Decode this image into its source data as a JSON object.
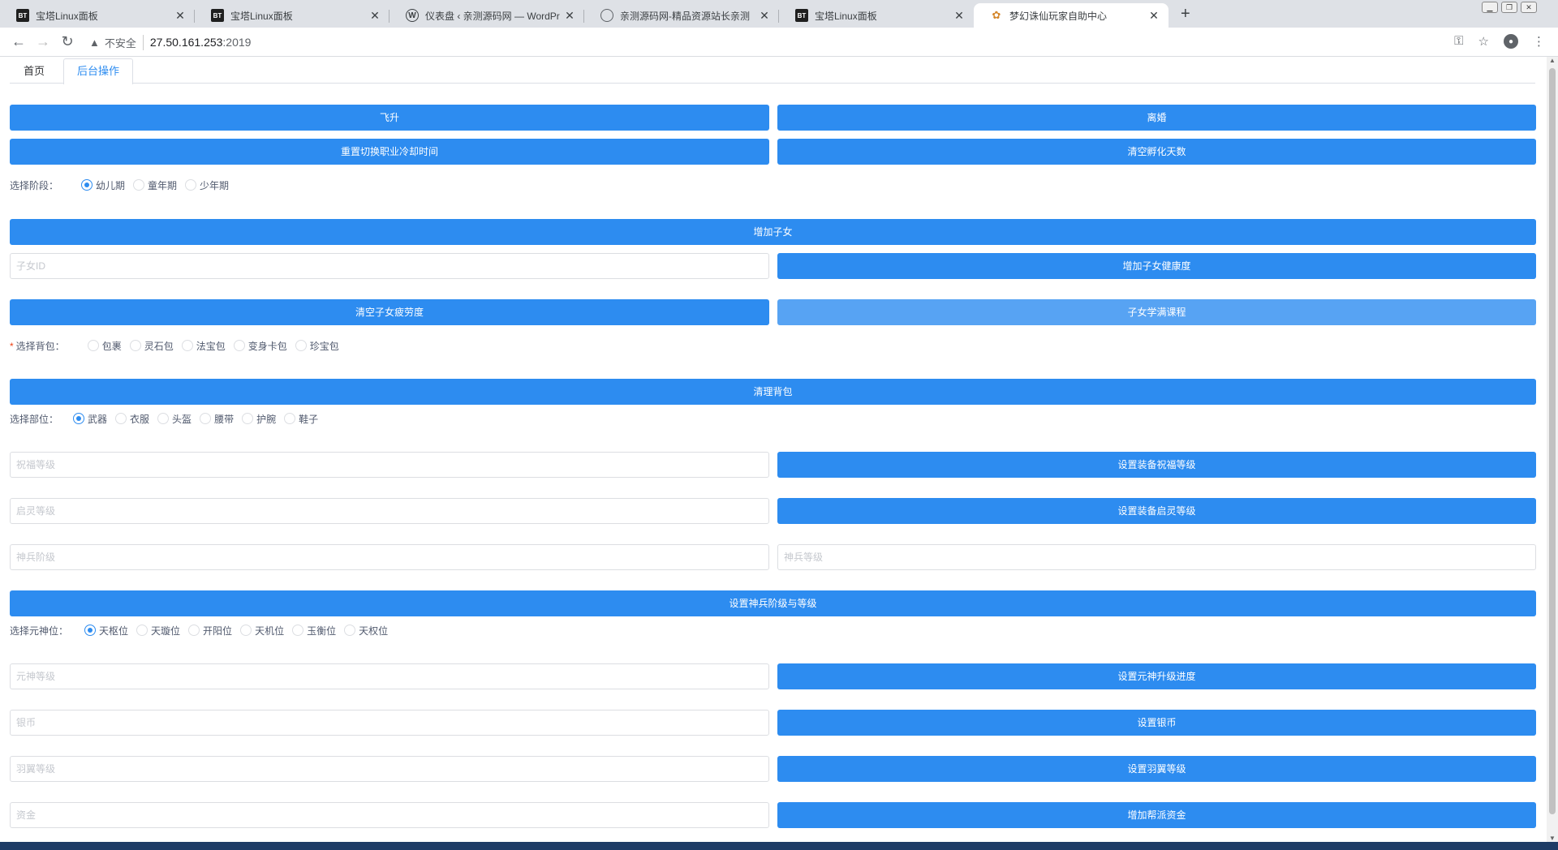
{
  "browser": {
    "tabs": [
      {
        "title": "宝塔Linux面板",
        "icon": "bt-icon"
      },
      {
        "title": "宝塔Linux面板",
        "icon": "bt-icon"
      },
      {
        "title": "仪表盘 ‹ 亲测源码网 — WordPr",
        "icon": "wordpress-icon"
      },
      {
        "title": "亲测源码网-精品资源站长亲测",
        "icon": "globe-icon"
      },
      {
        "title": "宝塔Linux面板",
        "icon": "bt-icon"
      },
      {
        "title": "梦幻诛仙玩家自助中心",
        "icon": "game-icon"
      }
    ],
    "active_tab": 5,
    "security_label": "不安全",
    "url_host": "27.50.161.253",
    "url_port": ":2019"
  },
  "page_tabs": [
    "首页",
    "后台操作"
  ],
  "active_page_tab": 1,
  "buttons": {
    "ascend": "飞升",
    "divorce": "离婚",
    "reset_job_cooldown": "重置切换职业冷却时间",
    "clear_incubation": "清空孵化天数",
    "add_child": "增加子女",
    "add_child_health": "增加子女健康度",
    "clear_child_fatigue": "清空子女疲劳度",
    "child_learn_all": "子女学满课程",
    "clear_bag": "清理背包",
    "set_blessing": "设置装备祝福等级",
    "set_awaken": "设置装备启灵等级",
    "set_weapon": "设置神兵阶级与等级",
    "set_soul_progress": "设置元神升级进度",
    "set_silver": "设置银币",
    "set_wing": "设置羽翼等级",
    "add_guild_fund": "增加帮派资金"
  },
  "inputs": {
    "child_id": "子女ID",
    "blessing_level": "祝福等级",
    "awaken_level": "启灵等级",
    "weapon_rank": "神兵阶级",
    "weapon_level": "神兵等级",
    "soul_level": "元神等级",
    "silver": "银币",
    "wing_level": "羽翼等级",
    "fund": "资金"
  },
  "radio_groups": {
    "stage": {
      "label": "选择阶段：",
      "options": [
        "幼儿期",
        "童年期",
        "少年期"
      ],
      "selected": 0
    },
    "bag": {
      "label": "选择背包：",
      "required": "*",
      "options": [
        "包裹",
        "灵石包",
        "法宝包",
        "变身卡包",
        "珍宝包"
      ],
      "selected": -1
    },
    "slot": {
      "label": "选择部位：",
      "options": [
        "武器",
        "衣服",
        "头盔",
        "腰带",
        "护腕",
        "鞋子"
      ],
      "selected": 0
    },
    "soul": {
      "label": "选择元神位：",
      "options": [
        "天枢位",
        "天璇位",
        "开阳位",
        "天机位",
        "玉衡位",
        "天权位"
      ],
      "selected": 0
    }
  }
}
